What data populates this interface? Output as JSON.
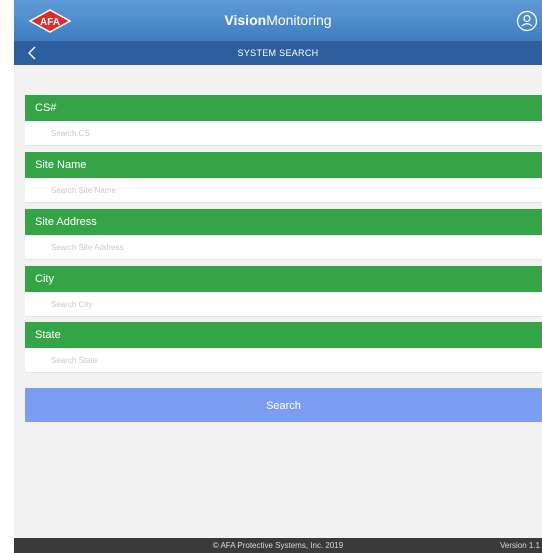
{
  "header": {
    "logo_text": "AFA",
    "title_bold": "Vision",
    "title_rest": "Monitoring",
    "user_icon": "user-circle-icon",
    "brand_color": "#4a88cb"
  },
  "subheader": {
    "back_icon": "chevron-left-icon",
    "title": "SYSTEM SEARCH"
  },
  "fields": [
    {
      "label": "CS#",
      "placeholder": "Search CS",
      "value": ""
    },
    {
      "label": "Site Name",
      "placeholder": "Search Site Name",
      "value": ""
    },
    {
      "label": "Site Address",
      "placeholder": "Search Site Address",
      "value": ""
    },
    {
      "label": "City",
      "placeholder": "Search City",
      "value": ""
    },
    {
      "label": "State",
      "placeholder": "Search State",
      "value": ""
    }
  ],
  "search_button": {
    "label": "Search"
  },
  "footer": {
    "copyright": "© AFA Protective Systems, Inc. 2019",
    "version": "Version 1.1"
  },
  "colors": {
    "field_header": "#35a446",
    "button": "#7d9ef0",
    "subheader": "#2d5f9e"
  }
}
